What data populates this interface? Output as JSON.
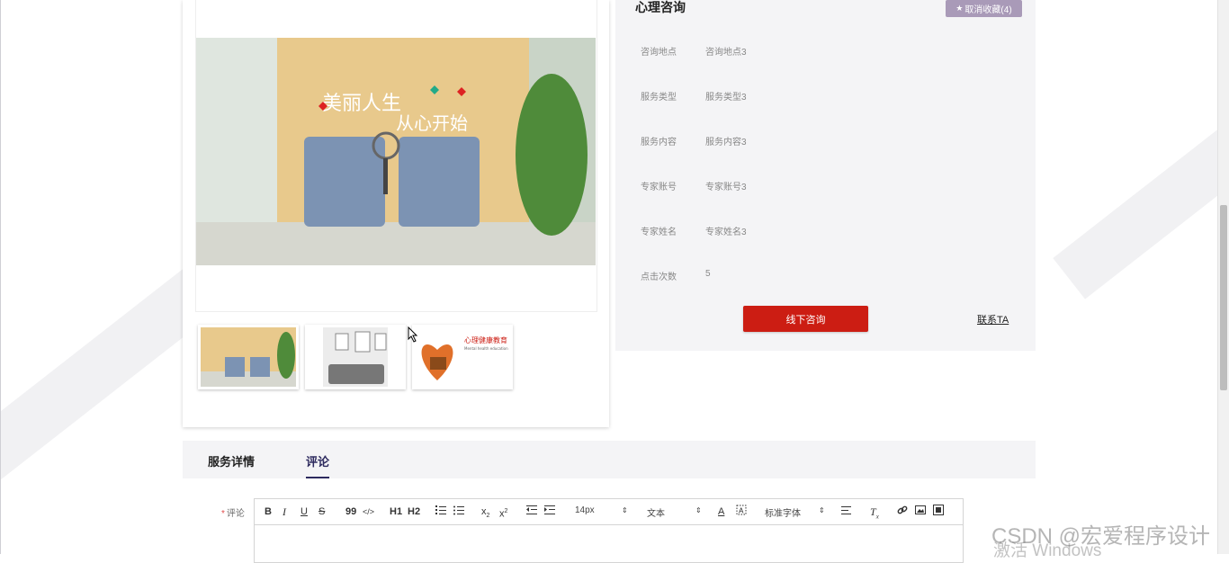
{
  "service": {
    "title": "心理咨询",
    "favorite_label": "取消收藏(4)",
    "fields": [
      {
        "label": "咨询地点",
        "value": "咨询地点3"
      },
      {
        "label": "服务类型",
        "value": "服务类型3"
      },
      {
        "label": "服务内容",
        "value": "服务内容3"
      },
      {
        "label": "专家账号",
        "value": "专家账号3"
      },
      {
        "label": "专家姓名",
        "value": "专家姓名3"
      },
      {
        "label": "点击次数",
        "value": "5"
      }
    ],
    "consult_button": "线下咨询",
    "contact_link": "联系TA"
  },
  "gallery": {
    "main_image_text": [
      "美丽人生",
      "从心开始"
    ],
    "thumb3_text": {
      "title": "心理健康教育",
      "subtitle": "Mental health education"
    },
    "thumbs": [
      "thumb-room",
      "thumb-office",
      "thumb-education"
    ]
  },
  "tabs": [
    {
      "label": "服务详情",
      "active": false
    },
    {
      "label": "评论",
      "active": true
    }
  ],
  "comment": {
    "label": "评论",
    "required_mark": "*",
    "toolbar": {
      "bold": "B",
      "italic": "I",
      "underline": "U",
      "strike": "S",
      "quote": "99",
      "code": "</>",
      "h1": "H1",
      "h2": "H2",
      "font_size": "14px",
      "text_style": "文本",
      "font_family": "标准字体"
    }
  },
  "watermark": {
    "csdn": "CSDN @宏爱程序设计",
    "activate": "激活 Windows"
  },
  "colors": {
    "accent_red": "#cc1d13",
    "favorite_purple": "#a99ab8",
    "tab_active": "#2d2a5e"
  }
}
